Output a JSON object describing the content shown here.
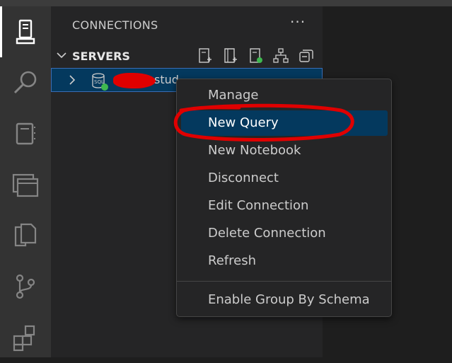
{
  "activity_bar": {
    "items": [
      {
        "id": "connections",
        "icon": "server-icon",
        "active": true
      },
      {
        "id": "search",
        "icon": "search-icon"
      },
      {
        "id": "notebooks",
        "icon": "notebook-icon"
      },
      {
        "id": "tabs",
        "icon": "windows-icon"
      },
      {
        "id": "explorer",
        "icon": "files-icon"
      },
      {
        "id": "source-control",
        "icon": "source-control-icon"
      },
      {
        "id": "extensions",
        "icon": "extensions-icon"
      }
    ]
  },
  "sidebar": {
    "title": "CONNECTIONS",
    "more_label": "···",
    "servers": {
      "label": "SERVERS",
      "server_name": "stud"
    }
  },
  "context_menu": {
    "items": [
      {
        "label": "Manage"
      },
      {
        "label": "New Query",
        "selected": true
      },
      {
        "label": "New Notebook"
      },
      {
        "label": "Disconnect"
      },
      {
        "label": "Edit Connection"
      },
      {
        "label": "Delete Connection"
      },
      {
        "label": "Refresh"
      },
      {
        "label": "Enable Group By Schema"
      }
    ]
  },
  "colors": {
    "accent": "#04395e",
    "active_border": "#3a6db5",
    "connected": "#3fb950",
    "annotation": "#e00000"
  }
}
